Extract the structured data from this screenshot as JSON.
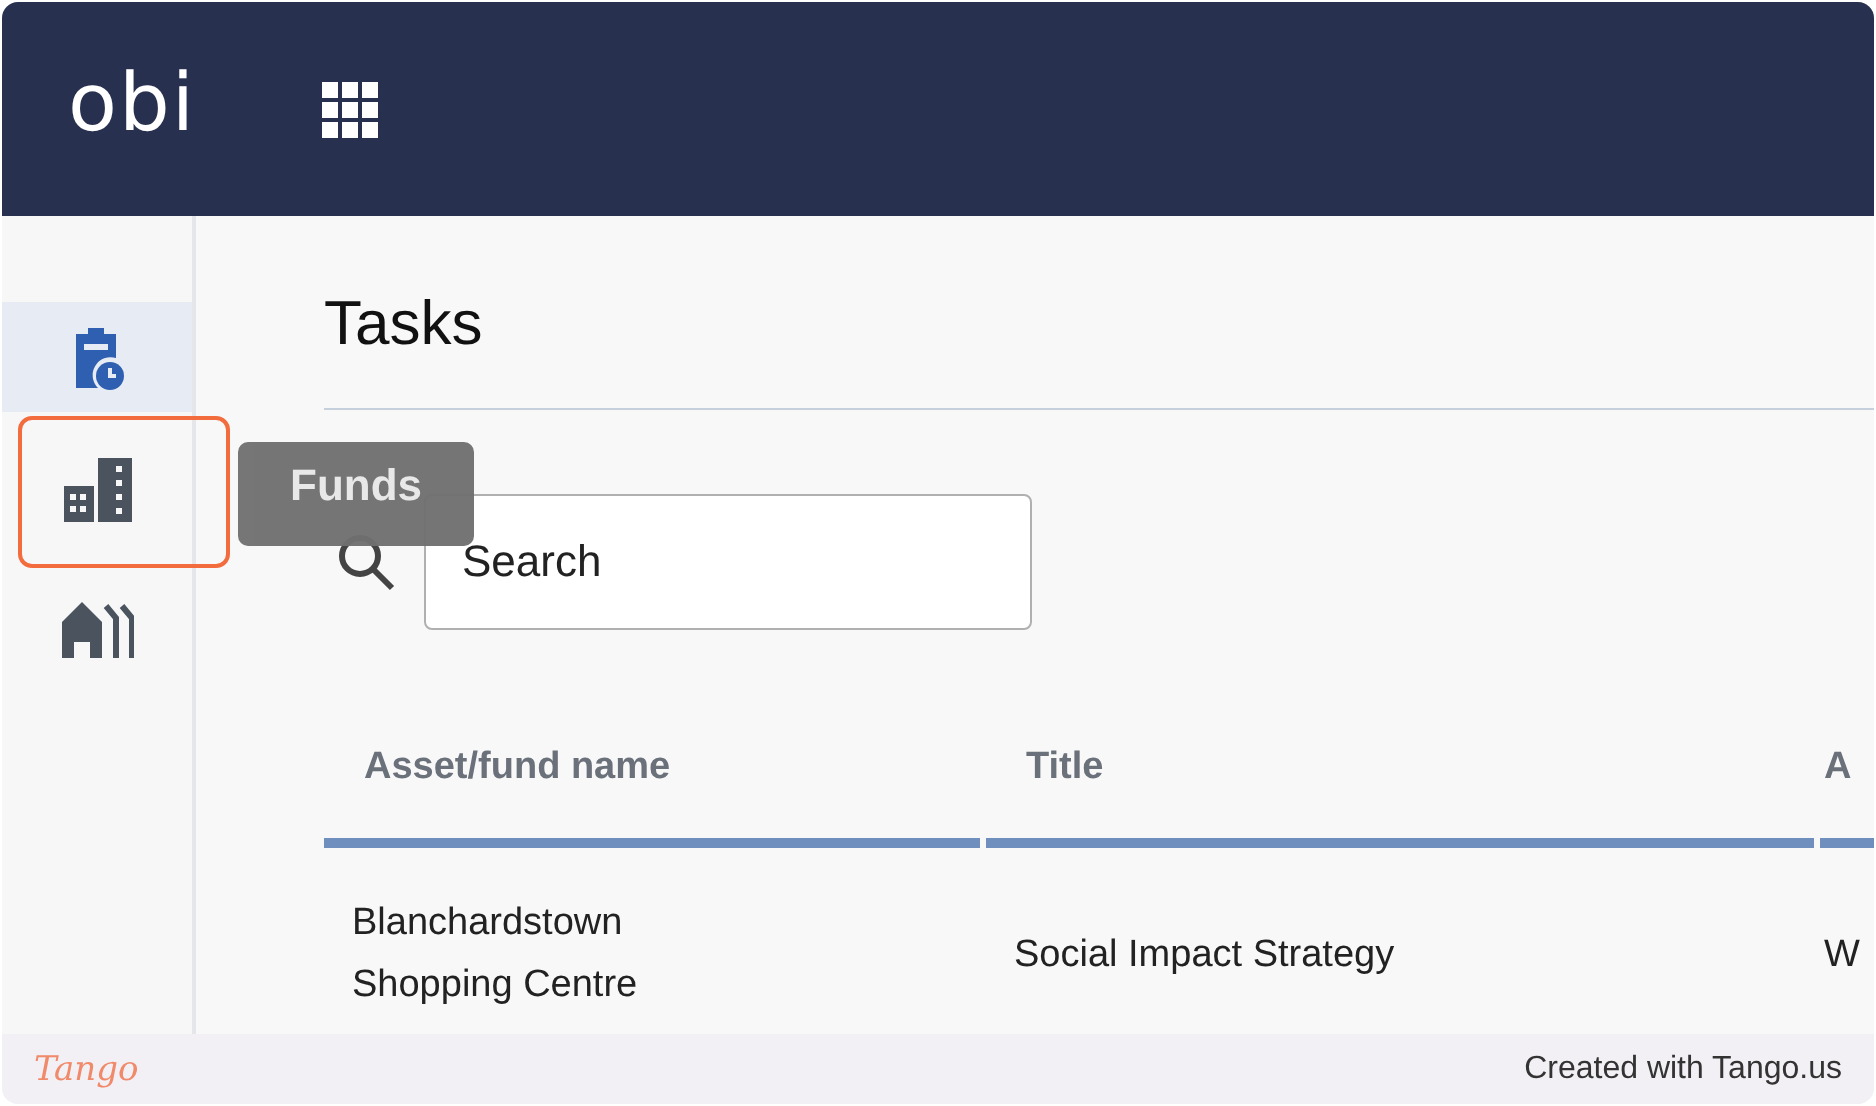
{
  "header": {
    "logo": "obi"
  },
  "sidebar": {
    "items": [
      {
        "kind": "tasks",
        "selected": true,
        "highlighted": false
      },
      {
        "kind": "funds",
        "selected": false,
        "highlighted": true,
        "tooltip": "Funds"
      },
      {
        "kind": "assets",
        "selected": false,
        "highlighted": false
      }
    ]
  },
  "page": {
    "title": "Tasks",
    "search": {
      "placeholder": "Search"
    }
  },
  "table": {
    "columns": [
      "Asset/fund name",
      "Title",
      "A"
    ],
    "rows": [
      [
        "Blanchardstown Shopping Centre",
        "Social Impact Strategy",
        "W"
      ]
    ]
  },
  "footer": {
    "brand": "Tango",
    "credit": "Created with Tango.us"
  }
}
